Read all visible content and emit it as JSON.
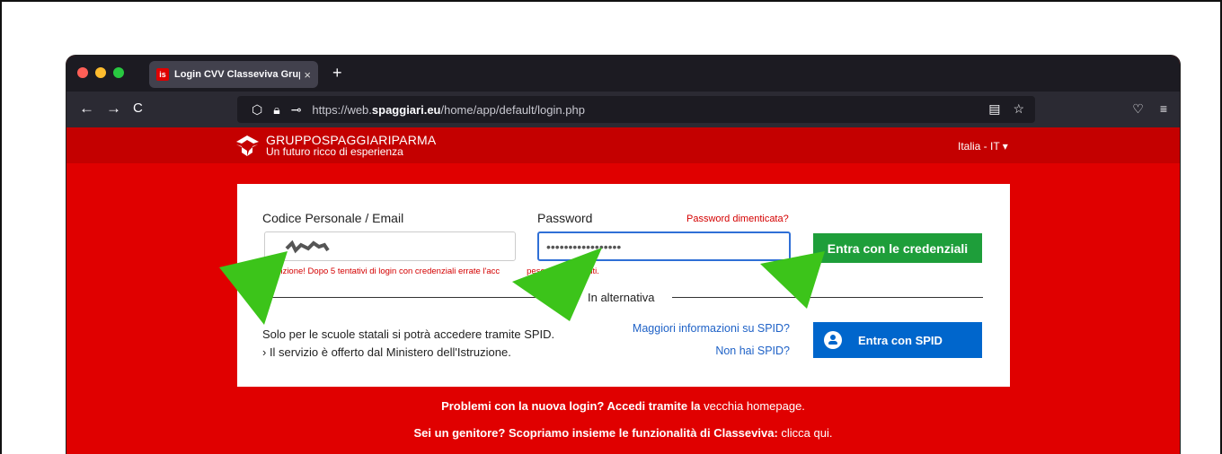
{
  "browser": {
    "tab_title": "Login CVV Classeviva Gruppo S",
    "tab_favicon": "is",
    "tab_close": "×",
    "new_tab": "+",
    "back": "←",
    "forward": "→",
    "reload": "C",
    "url_prefix": "https://web.",
    "url_host": "spaggiari.eu",
    "url_path": "/home/app/default/login.php",
    "reader_icon": "▤",
    "bookmark_icon": "☆",
    "pocket_icon": "♡",
    "menu_icon": "≡"
  },
  "site": {
    "logo_line1": "GRUPPOSPAGGIARIPARMA",
    "logo_line2": "Un futuro ricco di esperienza",
    "language": "Italia - IT ▾"
  },
  "login": {
    "user_label": "Codice Personale / Email",
    "user_value": "",
    "password_label": "Password",
    "password_value": "•••••••••••••••••",
    "forgot_link": "Password dimenticata?",
    "submit_button": "Entra con le credenziali",
    "warning": "enzione! Dopo 5 tentativi di login con credenziali errate l'acc",
    "warning_tail": "peso per 60 minuti.",
    "alternative": "In alternativa",
    "spid_note1": "Solo per le scuole statali si potrà accedere tramite SPID.",
    "spid_note2": "› Il servizio è offerto dal Ministero dell'Istruzione.",
    "spid_more_link": "Maggiori informazioni su SPID?",
    "spid_none_link": "Non hai SPID?",
    "spid_button": "Entra con SPID"
  },
  "footer": {
    "line1_bold": "Problemi con la nuova login? Accedi tramite la",
    "line1_link": "vecchia homepage.",
    "line2_bold": "Sei un genitore? Scopriamo insieme le funzionalità di Classeviva:",
    "line2_link": "clicca qui."
  },
  "colors": {
    "brand_red": "#e00000",
    "header_red": "#c40000",
    "green_button": "#1e9e3a",
    "spid_blue": "#0066cc",
    "arrow_green": "#3cc41a"
  }
}
